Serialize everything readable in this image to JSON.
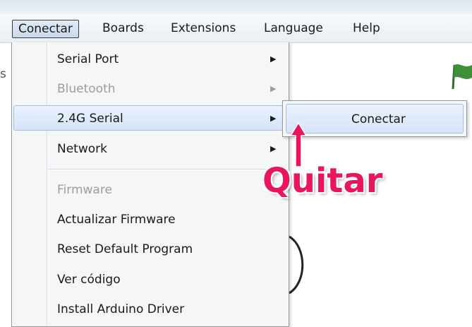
{
  "menubar": {
    "items": [
      "Conectar",
      "Boards",
      "Extensions",
      "Language",
      "Help"
    ]
  },
  "background": {
    "left_fragment": "s"
  },
  "menu": {
    "items": [
      {
        "label": "Serial Port",
        "has_submenu": true,
        "disabled": false
      },
      {
        "label": "Bluetooth",
        "has_submenu": true,
        "disabled": true
      },
      {
        "label": "2.4G Serial",
        "has_submenu": true,
        "disabled": false,
        "highlighted": true
      },
      {
        "label": "Network",
        "has_submenu": true,
        "disabled": false
      },
      {
        "label": "Firmware",
        "has_submenu": false,
        "disabled": true
      },
      {
        "label": "Actualizar Firmware",
        "has_submenu": false,
        "disabled": false
      },
      {
        "label": "Reset Default Program",
        "has_submenu": false,
        "disabled": false
      },
      {
        "label": "Ver código",
        "has_submenu": false,
        "disabled": false
      },
      {
        "label": "Install Arduino Driver",
        "has_submenu": false,
        "disabled": false
      }
    ]
  },
  "submenu": {
    "item": "Conectar"
  },
  "annotation": {
    "text": "Quitar",
    "color": "#e8175d"
  },
  "colors": {
    "highlight": "#d5e4f8",
    "disabled_text": "#9d9d9d",
    "flag": "#3f8f3a"
  },
  "icons": {
    "submenu_arrow": "submenu-arrow-icon",
    "flag": "green-flag-icon"
  }
}
